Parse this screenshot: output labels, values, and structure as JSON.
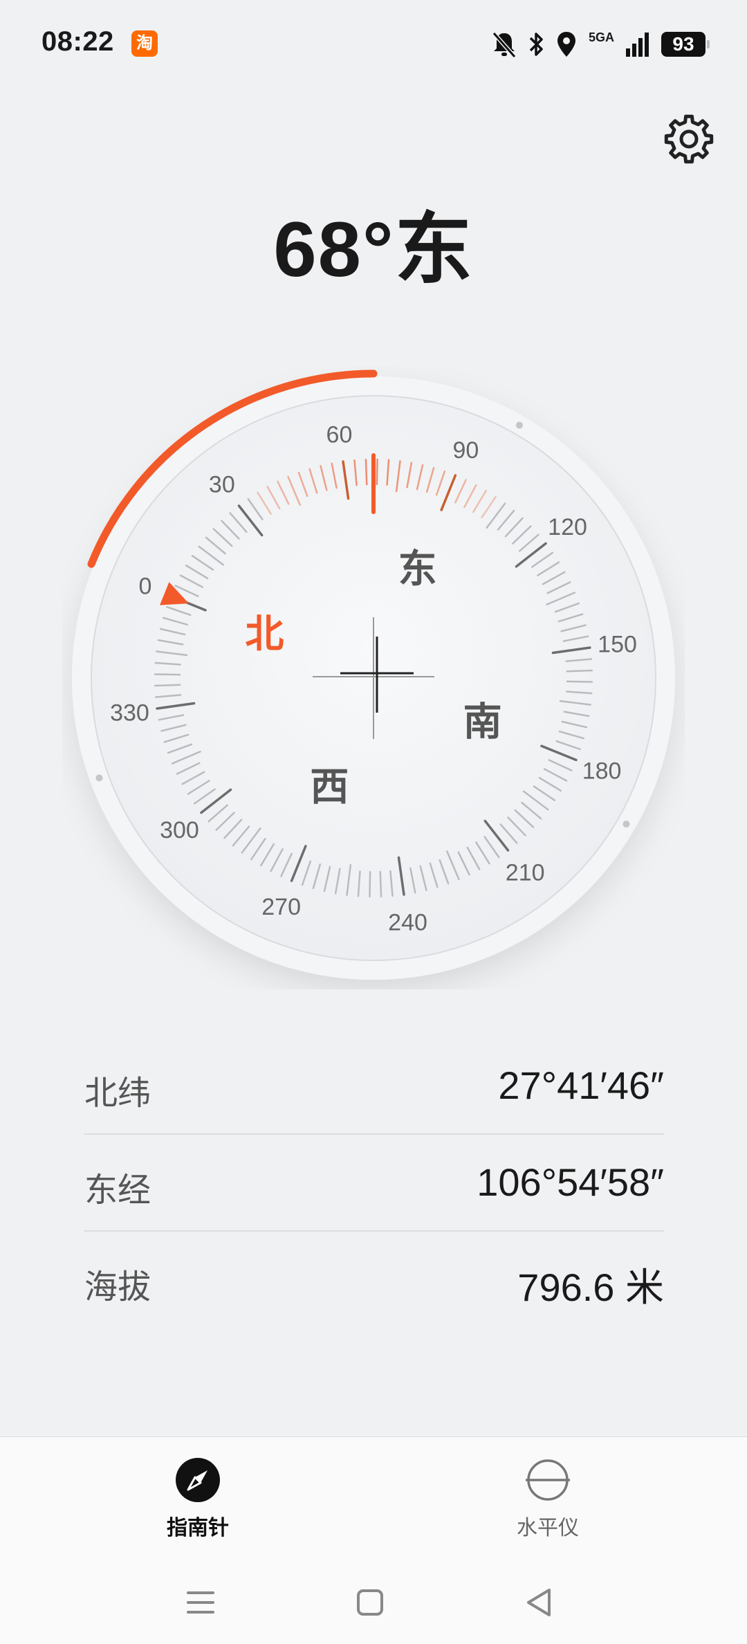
{
  "status_bar": {
    "time": "08:22",
    "app_badge": "淘",
    "network": "5GA",
    "battery": "93",
    "icons": [
      "bell-off-icon",
      "bluetooth-icon",
      "location-icon",
      "signal-icon",
      "battery-icon"
    ]
  },
  "heading": {
    "degrees": "68°",
    "direction": "东"
  },
  "compass": {
    "heading_value": 68,
    "marker_value": 0,
    "degree_labels": [
      "0",
      "30",
      "60",
      "90",
      "120",
      "150",
      "180",
      "210",
      "240",
      "270",
      "300",
      "330"
    ],
    "cardinals": {
      "north": "北",
      "east": "东",
      "south": "南",
      "west": "西"
    },
    "accent_color": "#f25a2a"
  },
  "coordinates": [
    {
      "label": "北纬",
      "value": "27°41′46″"
    },
    {
      "label": "东经",
      "value": "106°54′58″"
    },
    {
      "label": "海拔",
      "value": "796.6 米"
    }
  ],
  "tabs": [
    {
      "label": "指南针",
      "icon": "compass-icon",
      "active": true
    },
    {
      "label": "水平仪",
      "icon": "level-icon",
      "active": false
    }
  ],
  "nav": [
    "menu-icon",
    "home-icon",
    "back-icon"
  ]
}
